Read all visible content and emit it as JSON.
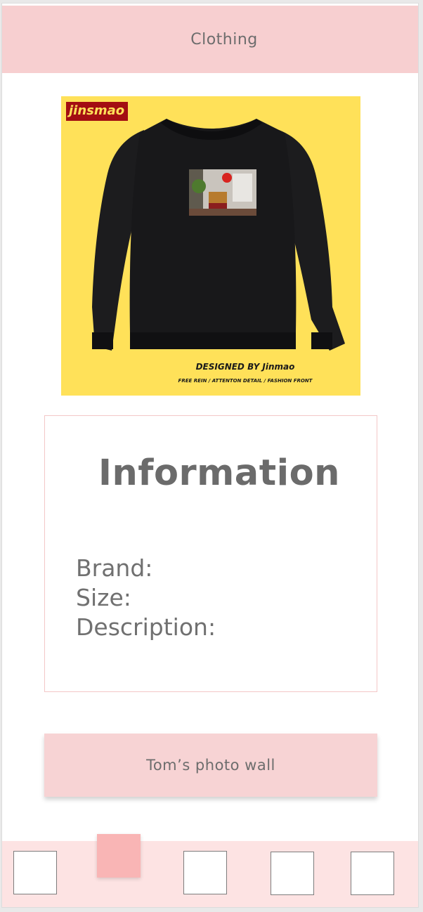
{
  "header": {
    "title": "Clothing"
  },
  "product": {
    "brand_tag": "jinsmao",
    "designed_by": "DESIGNED BY Jinmao",
    "tagline": "FREE REIN  /  ATTENTON DETAIL / FASHION FRONT",
    "image_icon": "black-sweatshirt-photo-print",
    "background_color": "#ffe159"
  },
  "info": {
    "title": "Information",
    "brand_label": "Brand:",
    "size_label": "Size:",
    "description_label": "Description:"
  },
  "cta": {
    "label": "Tom’s photo wall"
  },
  "tabbar": {
    "tabs": [
      {
        "name": "tab-1",
        "active": false
      },
      {
        "name": "tab-2",
        "active": true
      },
      {
        "name": "tab-3",
        "active": false
      },
      {
        "name": "tab-4",
        "active": false
      },
      {
        "name": "tab-5",
        "active": false
      }
    ],
    "active_color": "#f9b5b5",
    "background_color": "#fde3e3"
  },
  "colors": {
    "header": "#f7cfd0",
    "button": "#f7d3d4",
    "text": "#6d6d6d"
  }
}
